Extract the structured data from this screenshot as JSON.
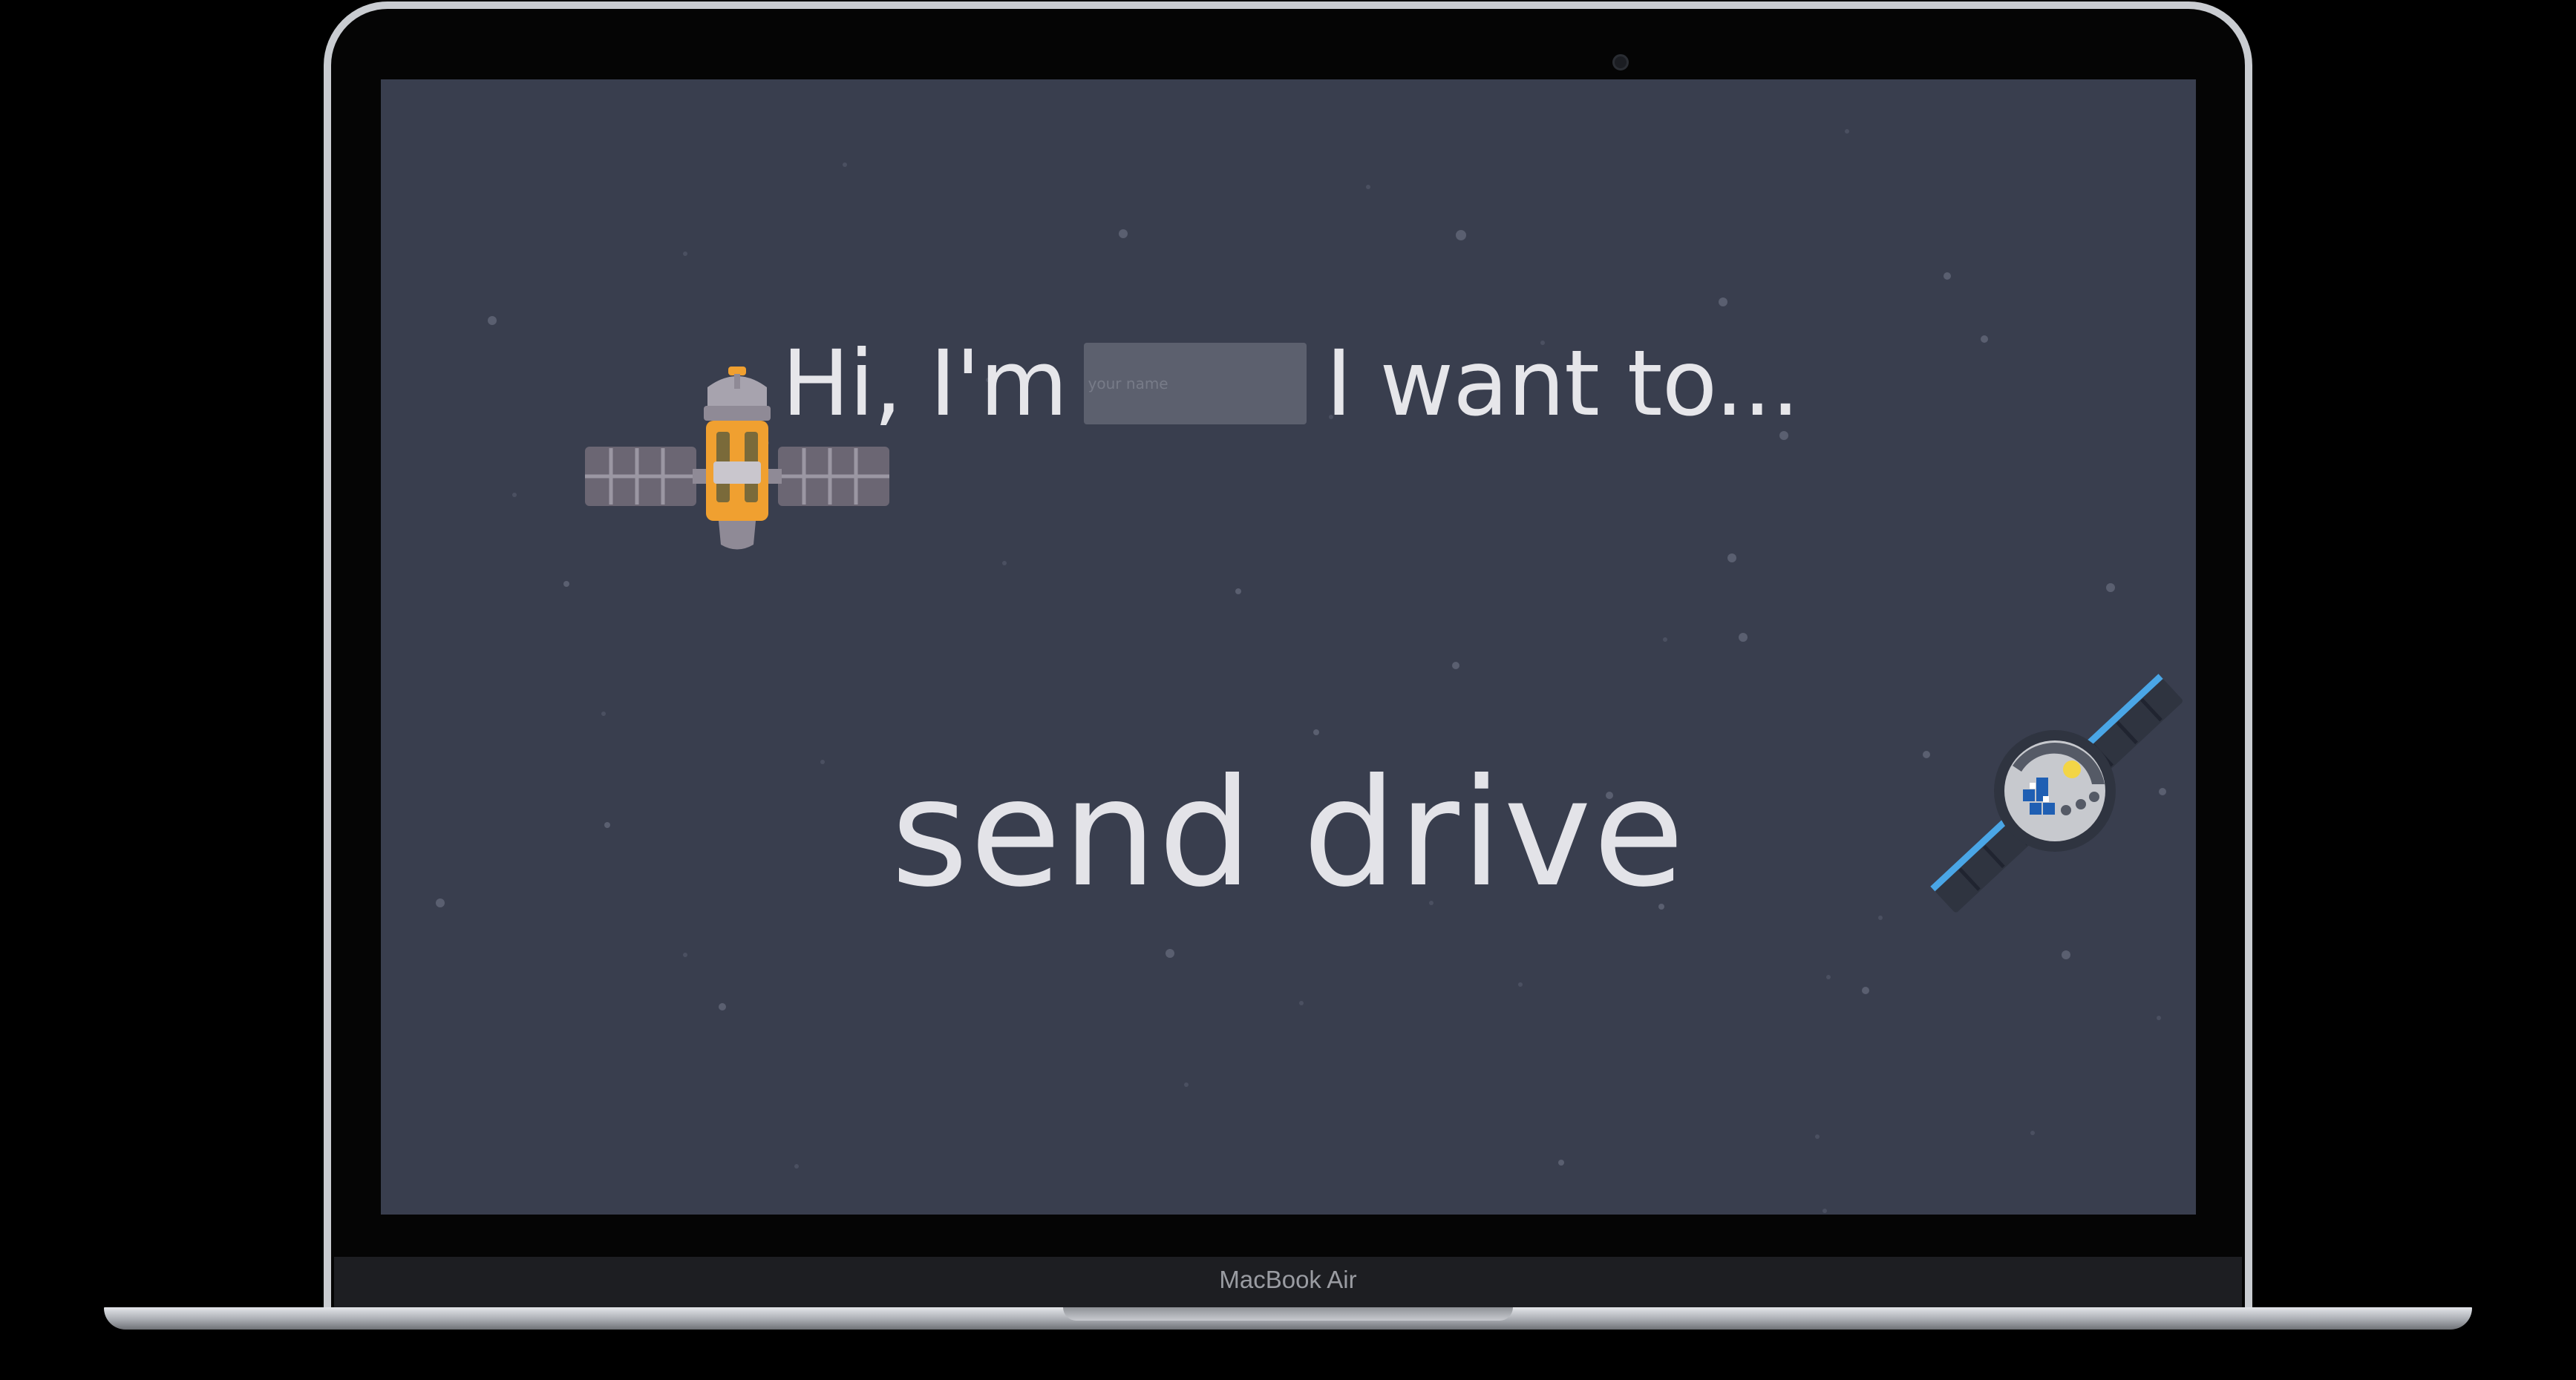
{
  "device": {
    "label": "MacBook Air"
  },
  "app": {
    "greeting_prefix": "Hi, I'm",
    "greeting_suffix": "I want to...",
    "name_field": {
      "placeholder": "your name",
      "value": ""
    },
    "action_text": "send drive"
  },
  "icons": {
    "left": "space-station-icon",
    "right": "satellite-icon"
  },
  "colors": {
    "background": "#393e4e",
    "text": "#e6e6ea",
    "input_fill": "#5c606e",
    "station_accent": "#f0a030",
    "solar_panel": "#4aa6e6"
  }
}
